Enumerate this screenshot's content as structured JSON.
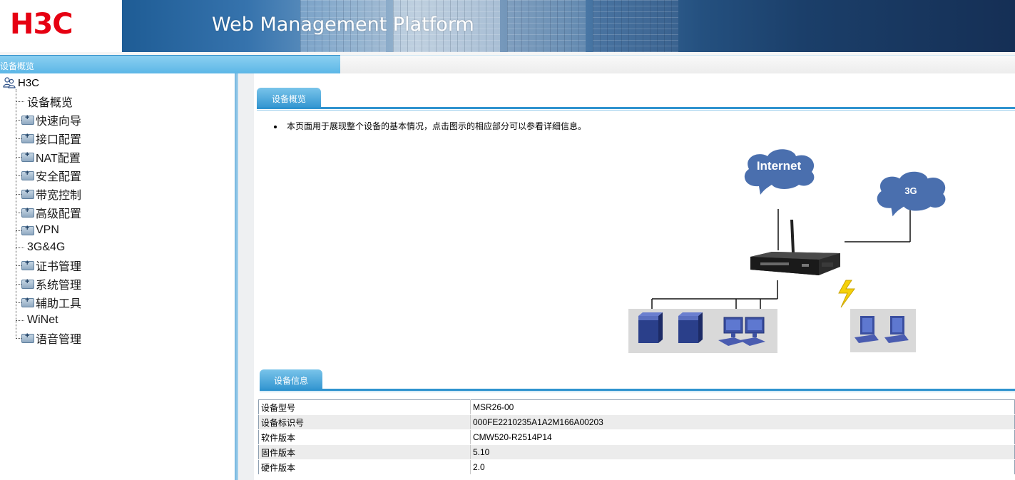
{
  "header": {
    "logo_text": "H3C",
    "platform_title": "Web Management Platform"
  },
  "nav": {
    "current_tab": "设备概览"
  },
  "sidebar": {
    "root_label": "H3C",
    "items": [
      {
        "label": "设备概览",
        "folder": false
      },
      {
        "label": "快速向导",
        "folder": true
      },
      {
        "label": "接口配置",
        "folder": true
      },
      {
        "label": "NAT配置",
        "folder": true
      },
      {
        "label": "安全配置",
        "folder": true
      },
      {
        "label": "带宽控制",
        "folder": true
      },
      {
        "label": "高级配置",
        "folder": true
      },
      {
        "label": "VPN",
        "folder": true
      },
      {
        "label": "3G&4G",
        "folder": false
      },
      {
        "label": "证书管理",
        "folder": true
      },
      {
        "label": "系统管理",
        "folder": true
      },
      {
        "label": "辅助工具",
        "folder": true
      },
      {
        "label": "WiNet",
        "folder": false
      },
      {
        "label": "语音管理",
        "folder": true
      }
    ]
  },
  "overview": {
    "section_title": "设备概览",
    "description": "本页面用于展现整个设备的基本情况，点击图示的相应部分可以参看详细信息。",
    "diagram": {
      "cloud_internet": "Internet",
      "cloud_3g": "3G"
    }
  },
  "device_info": {
    "section_title": "设备信息",
    "rows": [
      {
        "key": "设备型号",
        "value": "MSR26-00"
      },
      {
        "key": "设备标识号",
        "value": "000FE2210235A1A2M166A00203"
      },
      {
        "key": "软件版本",
        "value": "CMW520-R2514P14"
      },
      {
        "key": "固件版本",
        "value": "5.10"
      },
      {
        "key": "硬件版本",
        "value": "2.0"
      }
    ]
  },
  "colors": {
    "brand_red": "#e60012",
    "accent_blue": "#2f93cf",
    "cloud_blue": "#4a6fae"
  }
}
